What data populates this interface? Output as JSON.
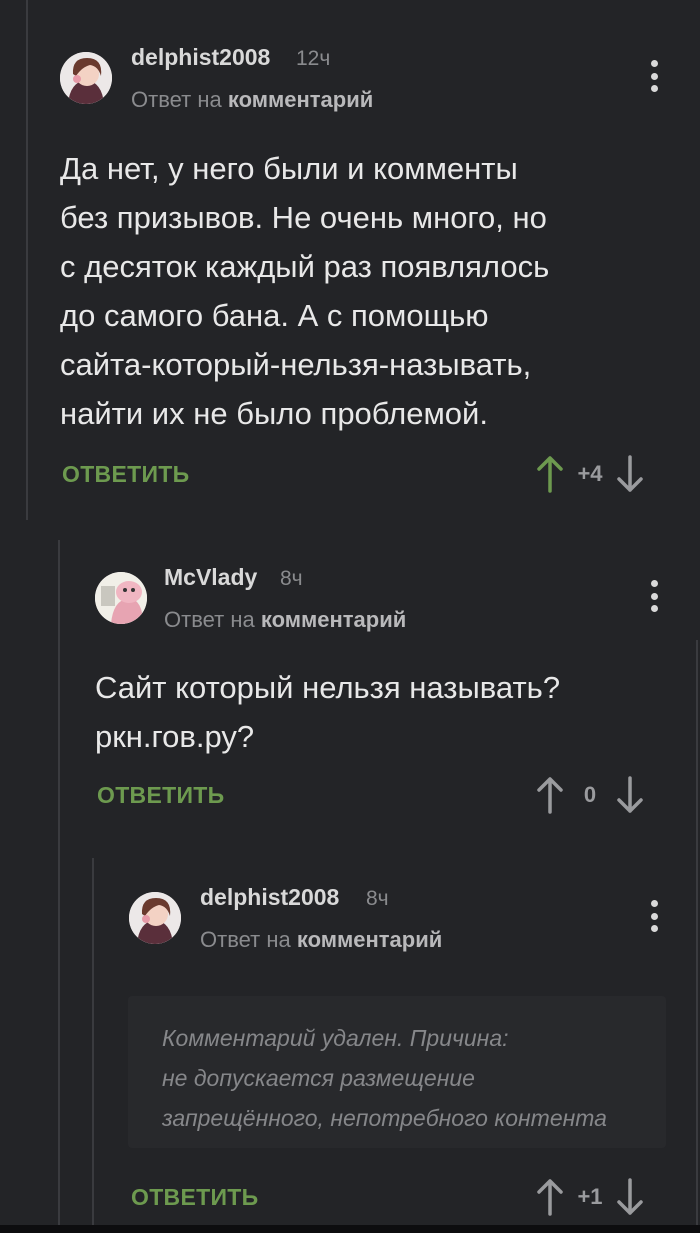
{
  "comments": [
    {
      "username": "delphist2008",
      "time": "12ч",
      "reply_prefix": "Ответ на",
      "reply_target": "комментарий",
      "text": "Да нет, у него были и комменты\nбез призывов. Не очень много, но\nс десяток каждый раз появлялось\nдо самого бана. А с помощью\nсайта-который-нельзя-называть,\nнайти их не было проблемой.",
      "reply_label": "ОТВЕТИТЬ",
      "score": "+4",
      "vote_state": "up"
    },
    {
      "username": "McVlady",
      "time": "8ч",
      "reply_prefix": "Ответ на",
      "reply_target": "комментарий",
      "text": "Сайт который нельзя называть?\nркн.гов.ру?",
      "reply_label": "ОТВЕТИТЬ",
      "score": "0",
      "vote_state": "none"
    },
    {
      "username": "delphist2008",
      "time": "8ч",
      "reply_prefix": "Ответ на",
      "reply_target": "комментарий",
      "deleted_text": "Комментарий удален. Причина:\nне допускается размещение\nзапрещённого, непотребного контента",
      "reply_label": "ОТВЕТИТЬ",
      "score": "+1",
      "vote_state": "none"
    }
  ],
  "colors": {
    "background": "#232427",
    "reply_green": "#6d9a4f",
    "upvote_active": "#6d9a4f",
    "vote_neutral": "#9a9b9e"
  },
  "icons": {
    "menu": "kebab-menu-icon",
    "upvote": "arrow-up-icon",
    "downvote": "arrow-down-icon"
  }
}
